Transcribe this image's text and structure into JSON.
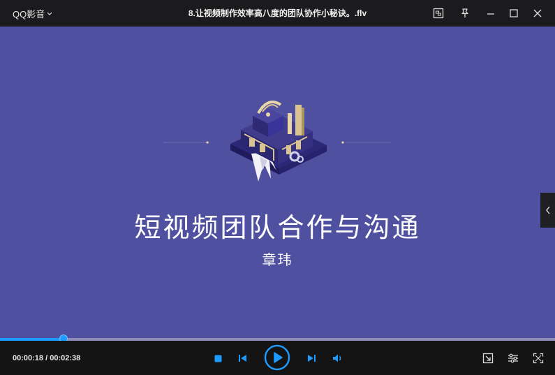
{
  "titlebar": {
    "app_name": "QQ影音",
    "file_title": "8.让视频制作效率高八度的团队协作小秘诀。.flv"
  },
  "video": {
    "title": "短视频团队合作与沟通",
    "author": "章玮"
  },
  "player": {
    "current_time": "00:00:18",
    "separator": " / ",
    "total_time": "00:02:38",
    "progress_fraction": 0.114
  },
  "colors": {
    "accent": "#1e9bff",
    "video_background": "#5050a0",
    "bar_background": "#141414"
  },
  "icons": [
    "chevron-down-icon",
    "screenshot-icon",
    "pin-icon",
    "minimize-icon",
    "maximize-icon",
    "close-icon",
    "stop-icon",
    "previous-icon",
    "play-icon",
    "next-icon",
    "volume-icon",
    "pip-icon",
    "settings-icon",
    "fullscreen-icon",
    "chevron-left-icon"
  ]
}
